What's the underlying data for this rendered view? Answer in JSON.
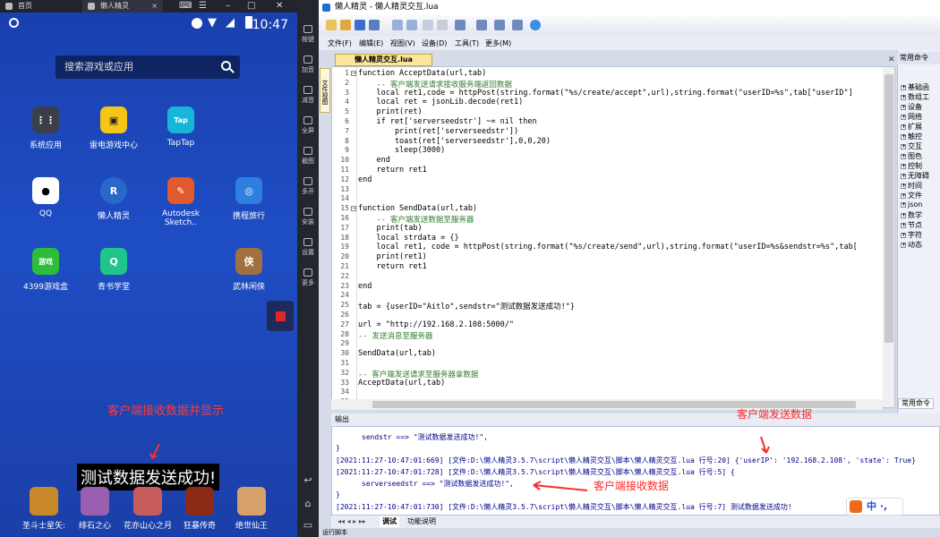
{
  "emulator": {
    "tabs": [
      {
        "label": "首页"
      },
      {
        "label": "懒人精灵"
      }
    ],
    "clock": "10:47",
    "search_placeholder": "搜索游戏或应用",
    "apps": [
      {
        "label": "系统应用",
        "color": "#3a3f4a",
        "glyph": "⋮⋮"
      },
      {
        "label": "雷电游戏中心",
        "color": "#f5c518",
        "glyph": "▣"
      },
      {
        "label": "TapTap",
        "color": "#17b5d8",
        "glyph": "Tap"
      },
      {
        "label": "QQ",
        "color": "#ffffff",
        "glyph": "🐧"
      },
      {
        "label": "懒人精灵",
        "color": "#2a68c8",
        "glyph": "R"
      },
      {
        "label": "Autodesk Sketch..",
        "color": "#e05a2b",
        "glyph": "✎"
      },
      {
        "label": "携程旅行",
        "color": "#2e7fe0",
        "glyph": "◎"
      },
      {
        "label": "4399游戏盒",
        "color": "#2dbd3a",
        "glyph": "游戏"
      },
      {
        "label": "青书学堂",
        "color": "#21c48a",
        "glyph": "Q"
      },
      {
        "label": "武林闲侠",
        "color": "#a07040",
        "glyph": "侠"
      }
    ],
    "received_label": "客户端接收数据并显示",
    "toast": "测试数据发送成功!",
    "dock": [
      {
        "label": "圣斗士星矢:",
        "color": "#c9892a"
      },
      {
        "label": "绯石之心",
        "color": "#9a5fb0"
      },
      {
        "label": "花亦山心之月",
        "color": "#c65c5c"
      },
      {
        "label": "狂暴传奇",
        "color": "#8b2b16"
      },
      {
        "label": "绝世仙王",
        "color": "#d8a06a"
      }
    ],
    "side_buttons": [
      "按键",
      "加音",
      "减音",
      "全屏",
      "截图",
      "多开",
      "安装",
      "设置",
      "更多"
    ]
  },
  "ide": {
    "title": "懒人精灵 - 懒人精灵交互.lua",
    "menu": [
      "文件(F)",
      "编辑(E)",
      "视图(V)",
      "设备(D)",
      "工具(T)",
      "更多(M)"
    ],
    "vertical_tab": "文件视图",
    "doc_tab": "懒人精灵交互.lua",
    "right_panel_title": "常用命令",
    "right_panel_items": [
      "基础函",
      "数组工",
      "设备",
      "网络",
      "扩展",
      "触控",
      "交互",
      "图色",
      "控制",
      "无障碍",
      "时间",
      "文件",
      "json",
      "数学",
      "节点",
      "字符",
      "动态"
    ],
    "right_bottom_tab": "常用命令",
    "code": [
      "function AcceptData(url,tab)",
      "    -- 客户端发送请求接收服务端返回数据",
      "    local ret1,code = httpPost(string.format(\"%s/create/accept\",url),string.format(\"userID=%s\",tab[\"userID\"]",
      "    local ret = jsonLib.decode(ret1)",
      "    print(ret)",
      "    if ret['serverseedstr'] ~= nil then",
      "        print(ret['serverseedstr'])",
      "        toast(ret['serverseedstr'],0,0,20)",
      "        sleep(3000)",
      "    end",
      "    return ret1",
      "end",
      "",
      "",
      "function SendData(url,tab)",
      "    -- 客户端发送数据至服务器",
      "    print(tab)",
      "    local strdata = {}",
      "    local ret1, code = httpPost(string.format(\"%s/create/send\",url),string.format(\"userID=%s&sendstr=%s\",tab[",
      "    print(ret1)",
      "    return ret1",
      "",
      "end",
      "",
      "tab = {userID=\"Aitlo\",sendstr=\"测试数据发送成功!\"}",
      "",
      "url = \"http://192.168.2.108:5000/\"",
      "-- 发送消息至服务器",
      "",
      "SendData(url,tab)",
      "",
      "-- 客户端发送请求至服务器拿数据",
      "AcceptData(url,tab)",
      "",
      ""
    ],
    "output_label": "输出",
    "output_lines": [
      "      sendstr ==> \"测试数据发送成功!\",",
      "}",
      "[2021:11:27-10:47:01:669] [文件:D:\\懒人精灵3.5.7\\script\\懒人精灵交互\\脚本\\懒人精灵交互.lua 行号:20] {'userIP': '192.168.2.108', 'state': True}",
      "[2021:11:27-10:47:01:728] [文件:D:\\懒人精灵3.5.7\\script\\懒人精灵交互\\脚本\\懒人精灵交互.lua 行号:5] {",
      "      serverseedstr ==> \"测试数据发送成功!\",",
      "}",
      "[2021:11:27-10:47:01:730] [文件:D:\\懒人精灵3.5.7\\script\\懒人精灵交互\\脚本\\懒人精灵交互.lua 行号:7] 测试数据发送成功!"
    ],
    "annotation_send": "客户端发送数据",
    "annotation_recv": "客户端接收数据",
    "bottom_tabs": [
      "调试",
      "功能说明"
    ],
    "status": "运行脚本",
    "ime": "中 ·,"
  }
}
